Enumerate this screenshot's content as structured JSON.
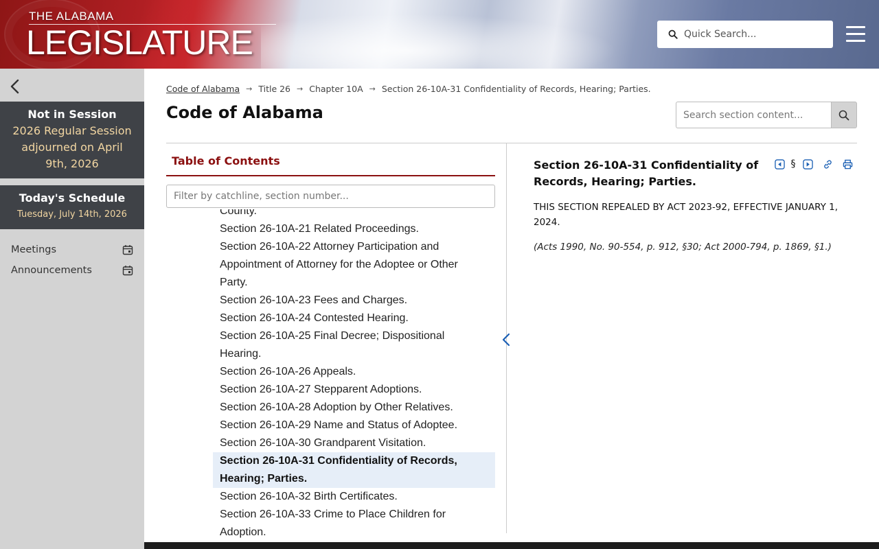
{
  "header": {
    "logo_top": "THE ALABAMA",
    "logo_main": "LEGISLATURE",
    "quick_search_placeholder": "Quick Search..."
  },
  "sidebar": {
    "session_status": "Not in Session",
    "session_detail": "2026 Regular Session adjourned on April 9th, 2026",
    "schedule_title": "Today's Schedule",
    "schedule_date": "Tuesday, July 14th, 2026",
    "links": [
      {
        "label": "Meetings",
        "icon": "calendar-icon"
      },
      {
        "label": "Announcements",
        "icon": "calendar-icon"
      }
    ]
  },
  "breadcrumb": {
    "root": "Code of Alabama",
    "items": [
      "Title 26",
      "Chapter 10A",
      "Section 26-10A-31 Confidentiality of Records, Hearing; Parties."
    ],
    "separator": "→"
  },
  "page_title": "Code of Alabama",
  "section_search_placeholder": "Search section content...",
  "toc": {
    "title": "Table of Contents",
    "filter_placeholder": "Filter by catchline, section number...",
    "items": [
      "County.",
      "Section 26-10A-21 Related Proceedings.",
      "Section 26-10A-22 Attorney Participation and Appointment of Attorney for the Adoptee or Other Party.",
      "Section 26-10A-23 Fees and Charges.",
      "Section 26-10A-24 Contested Hearing.",
      "Section 26-10A-25 Final Decree; Dispositional Hearing.",
      "Section 26-10A-26 Appeals.",
      "Section 26-10A-27 Stepparent Adoptions.",
      "Section 26-10A-28 Adoption by Other Relatives.",
      "Section 26-10A-29 Name and Status of Adoptee.",
      "Section 26-10A-30 Grandparent Visitation.",
      "Section 26-10A-31 Confidentiality of Records, Hearing; Parties.",
      "Section 26-10A-32 Birth Certificates.",
      "Section 26-10A-33 Crime to Place Children for Adoption."
    ],
    "active_index": 11
  },
  "section": {
    "title": "Section 26-10A-31 Confidentiality of Records, Hearing; Parties.",
    "section_symbol": "§",
    "body": "THIS SECTION REPEALED BY ACT 2023-92, EFFECTIVE JANUARY 1, 2024.",
    "history": "(Acts 1990, No. 90-554, p. 912, §30; Act 2000-794, p. 1869, §1.)"
  },
  "colors": {
    "toc_accent": "#8b1010",
    "sidebar_bg": "#d3d3d3",
    "panel_bg": "#3f4247",
    "panel_text": "#f2d6a2",
    "active_row": "#e6eef8",
    "link_blue": "#1a5fb4"
  }
}
